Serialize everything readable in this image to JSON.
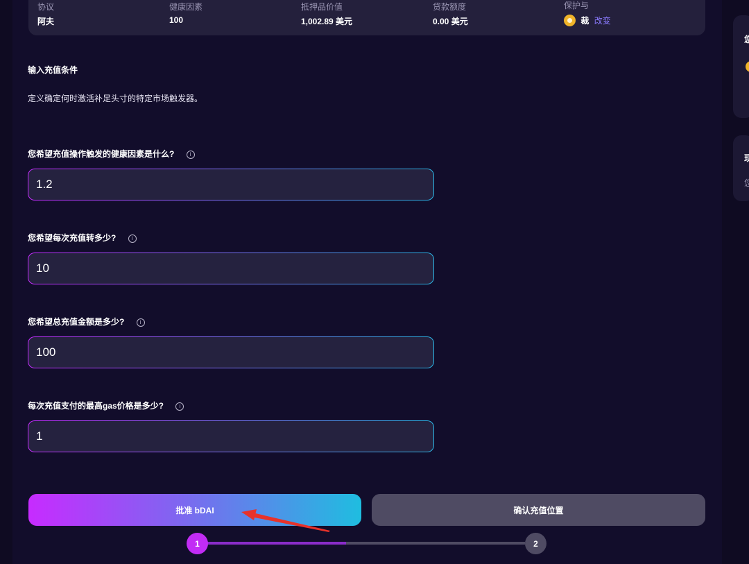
{
  "summary": {
    "columns": [
      {
        "head": "协议",
        "value": "阿夫"
      },
      {
        "head": "健康因素",
        "value": "100"
      },
      {
        "head": "抵押品价值",
        "value": "1,002.89 美元"
      },
      {
        "head": "贷款额度",
        "value": "0.00 美元"
      },
      {
        "head": "保护与",
        "value": "裁",
        "change_label": "改变",
        "icon": "coin-icon"
      }
    ]
  },
  "section": {
    "title": "输入充值条件",
    "description": "定义确定何时激活补足头寸的特定市场触发器。"
  },
  "fields": [
    {
      "label": "您希望充值操作触发的健康因素是什么?",
      "value": "1.2"
    },
    {
      "label": "您希望每次充值转多少?",
      "value": "10"
    },
    {
      "label": "您希望总充值金额是多少?",
      "value": "100"
    },
    {
      "label": "每次充值支付的最高gas价格是多少?",
      "value": "1"
    }
  ],
  "info_glyph": "i",
  "buttons": {
    "approve": "批准 bDAI",
    "confirm": "确认充值位置"
  },
  "steps": {
    "current": "1",
    "next": "2",
    "progress": 0.5
  },
  "side": {
    "card_one_title": "您",
    "card_two_title": "现",
    "card_two_text": "您"
  },
  "colors": {
    "background": "#0f0b22",
    "panel": "#120d2b",
    "input_bg": "#25223f",
    "gradient_start": "#c72bff",
    "gradient_end": "#1fbde0",
    "annotation_arrow": "#e8322a",
    "link": "#8b7bff"
  }
}
